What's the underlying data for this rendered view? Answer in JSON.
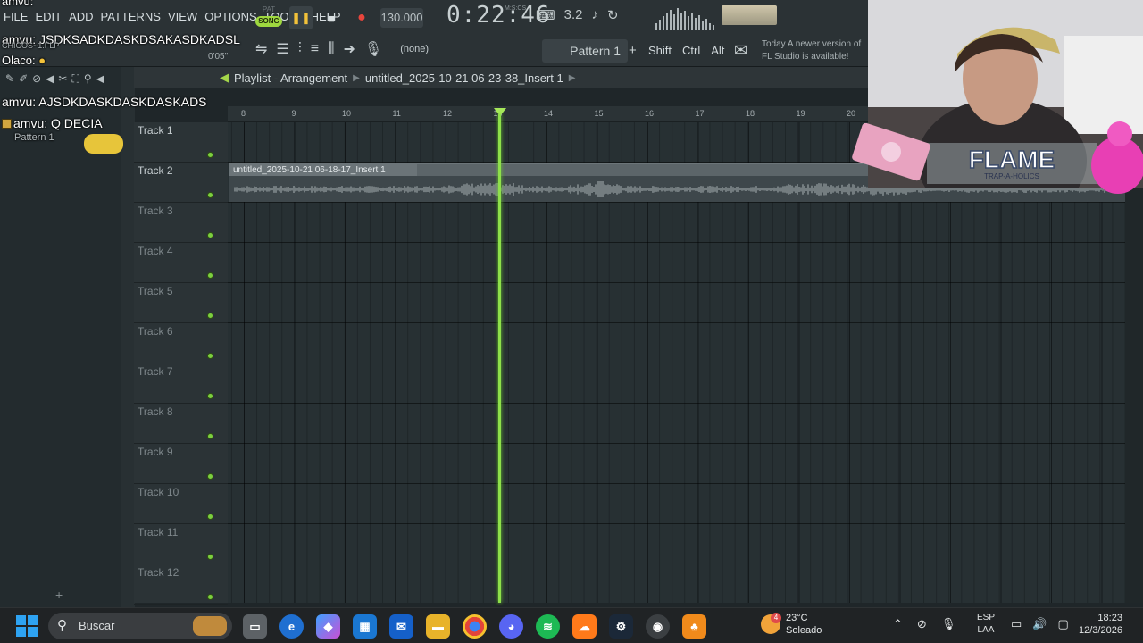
{
  "menu": [
    "FILE",
    "EDIT",
    "ADD",
    "PATTERNS",
    "VIEW",
    "OPTIONS",
    "TOOLS",
    "HELP"
  ],
  "transport": {
    "pat_label": "PAT",
    "song_label": "SONG",
    "tempo": "130.000",
    "time": "0:22:46",
    "time_label": "M:S:CS",
    "step_value": "3.2"
  },
  "toolbar2": {
    "channel_select": "(none)",
    "pattern": "Pattern 1",
    "keys": [
      "Shift",
      "Ctrl",
      "Alt"
    ]
  },
  "news": {
    "line1": "Today  A newer version of",
    "line2": "FL Studio is available!"
  },
  "chat": [
    "amvu: JSDKSADKDASKDSAKASDKADSL",
    "Olaco:",
    "amvu: AJSDKDASKDASKDASKADS",
    "amvu: Q DECIA"
  ],
  "browser": {
    "file_name": "CHICOS~1.FLP",
    "time": "0'05\"",
    "pattern_item": "Pattern 1"
  },
  "playlist": {
    "title": "Playlist - Arrangement",
    "project": "untitled_2025-10-21 06-23-38_Insert 1",
    "ruler": [
      "8",
      "9",
      "10",
      "11",
      "12",
      "13",
      "14",
      "15",
      "16",
      "17",
      "18",
      "19",
      "20"
    ],
    "tracks": [
      "Track 1",
      "Track 2",
      "Track 3",
      "Track 4",
      "Track 5",
      "Track 6",
      "Track 7",
      "Track 8",
      "Track 9",
      "Track 10",
      "Track 11",
      "Track 12"
    ],
    "clip_name": "untitled_2025-10-21 06-18-17_Insert 1",
    "playhead_bar": 13
  },
  "overlay": {
    "brand": "FLAME",
    "tagline": "TRAP-A-HOLICS"
  },
  "taskbar": {
    "search_placeholder": "Buscar",
    "weather_temp": "23°C",
    "weather_desc": "Soleado",
    "weather_badge": "4",
    "lang_line1": "ESP",
    "lang_line2": "LAA",
    "time": "18:23",
    "date": "12/3/2026"
  },
  "colors": {
    "accent_green": "#8ee04a",
    "song_badge": "#9fd93f",
    "record_red": "#e8453c",
    "play_yellow": "#f3c23a"
  }
}
